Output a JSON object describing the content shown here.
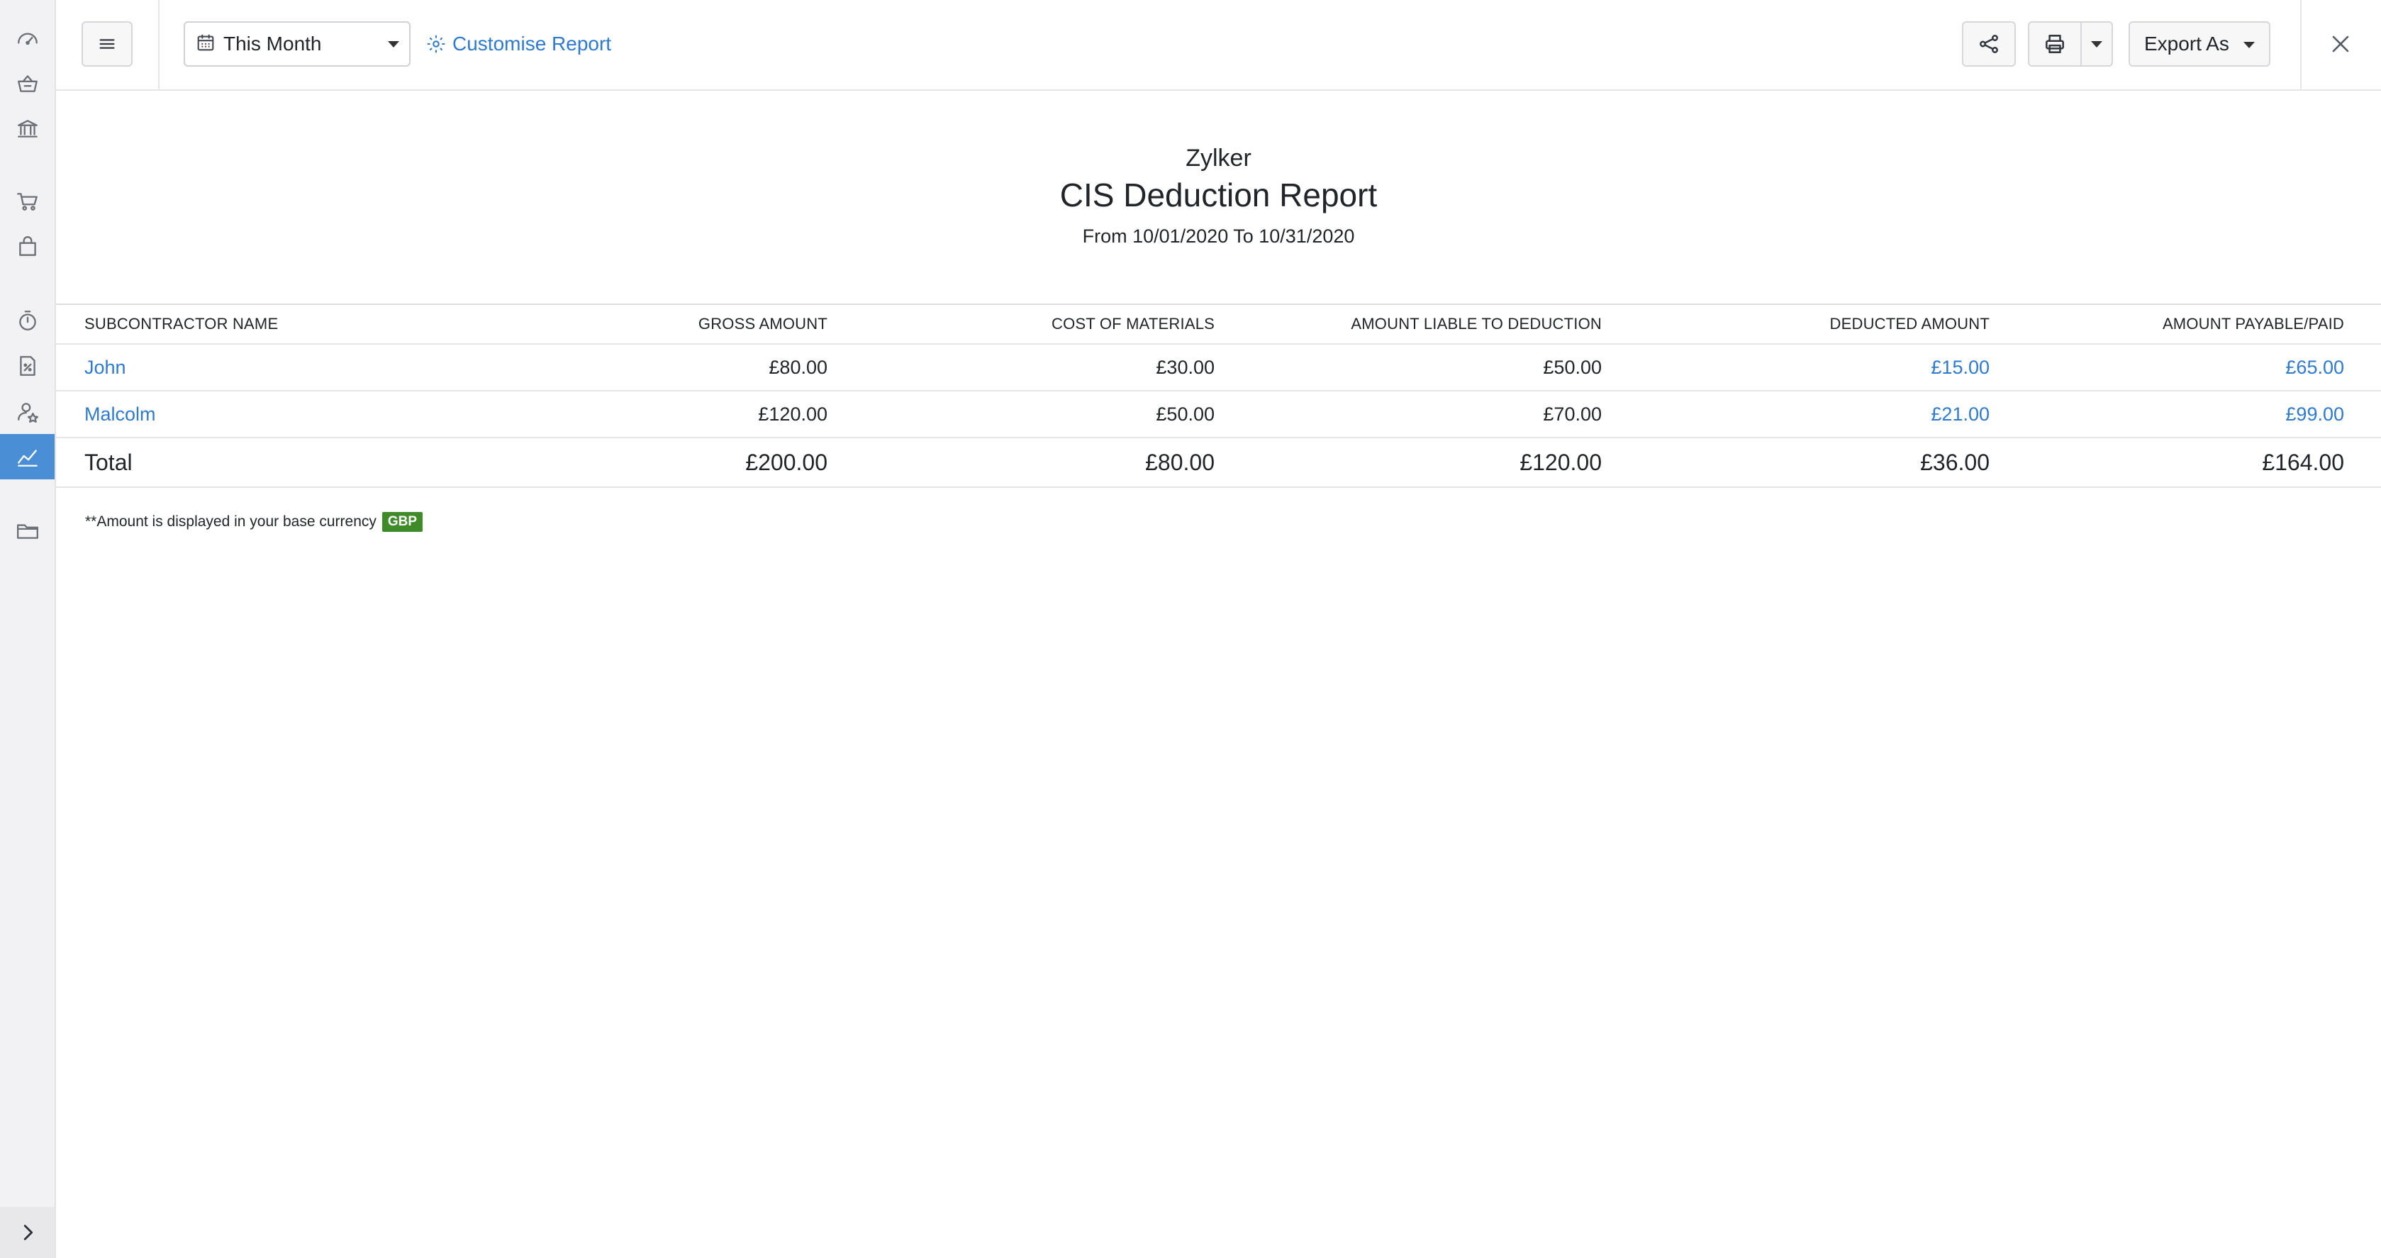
{
  "toolbar": {
    "period_label": "This Month",
    "customise_label": "Customise Report",
    "export_label": "Export As"
  },
  "report": {
    "organization": "Zylker",
    "title": "CIS Deduction Report",
    "date_range": "From 10/01/2020 To 10/31/2020"
  },
  "table": {
    "columns": [
      "SUBCONTRACTOR NAME",
      "GROSS AMOUNT",
      "COST OF MATERIALS",
      "AMOUNT LIABLE TO DEDUCTION",
      "DEDUCTED AMOUNT",
      "AMOUNT PAYABLE/PAID"
    ],
    "rows": [
      {
        "name": "John",
        "gross": "£80.00",
        "materials": "£30.00",
        "liable": "£50.00",
        "deducted": "£15.00",
        "payable": "£65.00"
      },
      {
        "name": "Malcolm",
        "gross": "£120.00",
        "materials": "£50.00",
        "liable": "£70.00",
        "deducted": "£21.00",
        "payable": "£99.00"
      }
    ],
    "total": {
      "label": "Total",
      "gross": "£200.00",
      "materials": "£80.00",
      "liable": "£120.00",
      "deducted": "£36.00",
      "payable": "£164.00"
    }
  },
  "footer": {
    "note": "**Amount is displayed in your base currency",
    "currency": "GBP"
  },
  "colors": {
    "accent": "#2f7ad1",
    "active_nav": "#4a8fd6",
    "currency_badge": "#3f8b2a"
  },
  "nav": {
    "icons": [
      "dashboard-icon",
      "basket-icon",
      "bank-icon",
      "cart-icon",
      "bag-icon",
      "timer-icon",
      "tax-document-icon",
      "contact-icon",
      "reports-chart-icon",
      "folder-icon"
    ],
    "active": "reports-chart-icon"
  }
}
